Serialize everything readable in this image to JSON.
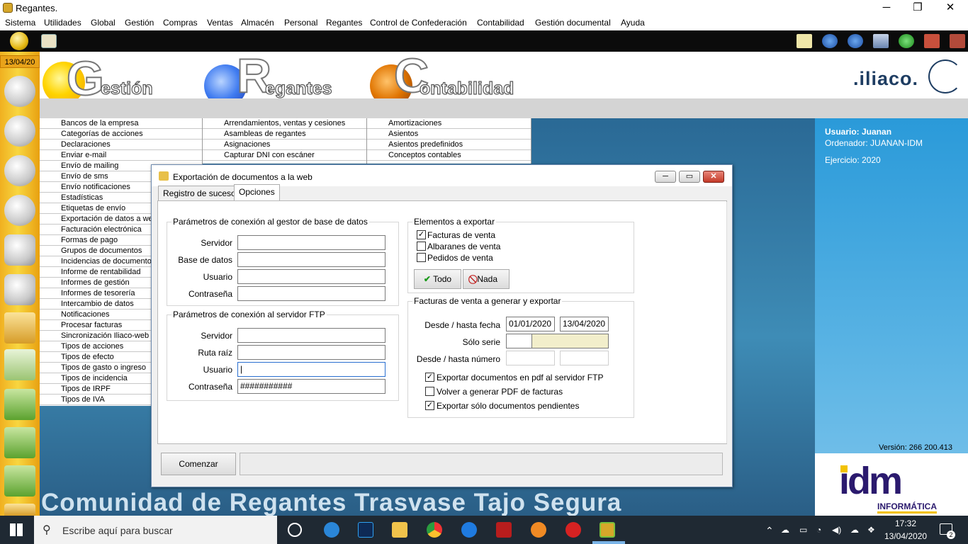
{
  "window": {
    "title": "Regantes.",
    "minimize": "─",
    "maximize": "❐",
    "close": "✕"
  },
  "menu": [
    "Sistema",
    "Utilidades",
    "Global",
    "Gestión",
    "Compras",
    "Ventas",
    "Almacén",
    "Personal",
    "Regantes",
    "Control de Confederación",
    "Contabilidad",
    "Gestión documental",
    "Ayuda"
  ],
  "date_badge": "13/04/20",
  "logos": {
    "gestion": {
      "initial": "G",
      "rest": "estión"
    },
    "regantes": {
      "initial": "R",
      "rest": "egantes"
    },
    "contabilidad": {
      "initial": "C",
      "rest": "ontabilidad"
    },
    "iliaco": ".iliaco."
  },
  "lists": {
    "gestion": [
      "Bancos de la empresa",
      "Categorías de acciones",
      "Declaraciones",
      "Enviar e-mail",
      "Envío de mailing",
      "Envío de sms",
      "Envío notificaciones",
      "Estadísticas",
      "Etiquetas de envío",
      "Exportación de datos a web",
      "Facturación electrónica",
      "Formas de pago",
      "Grupos de documentos",
      "Incidencias de documentos",
      "Informe de rentabilidad",
      "Informes de gestión",
      "Informes de tesorería",
      "Intercambio de datos",
      "Notificaciones",
      "Procesar facturas",
      "Sincronización Iliaco-web",
      "Tipos de acciones",
      "Tipos de efecto",
      "Tipos de gasto o ingreso",
      "Tipos de incidencia",
      "Tipos de IRPF",
      "Tipos de IVA"
    ],
    "regantes": [
      "Arrendamientos, ventas y cesiones",
      "Asambleas de regantes",
      "Asignaciones",
      "Capturar DNI con escáner"
    ],
    "contabilidad": [
      "Amortizaciones",
      "Asientos",
      "Asientos predefinidos",
      "Conceptos contables"
    ]
  },
  "user_panel": {
    "usuario": "Usuario: Juanan",
    "ordenador": "Ordenador: JUANAN-IDM",
    "ejercicio": "Ejercicio: 2020",
    "version": "Versión: 266 200.413"
  },
  "brand": {
    "idm": "idm",
    "sub": "INFORMÁTICA"
  },
  "footer_text": "Comunidad de Regantes Trasvase Tajo Segura",
  "dialog": {
    "title": "Exportación de documentos a la web",
    "tabs": [
      "Registro de sucesos",
      "Opciones"
    ],
    "db_group": {
      "title": "Parámetros de conexión al gestor de base de datos",
      "servidor": "Servidor",
      "base_datos": "Base de datos",
      "usuario": "Usuario",
      "contrasena": "Contraseña",
      "servidor_val": "",
      "base_datos_val": "",
      "usuario_val": "",
      "contrasena_val": ""
    },
    "ftp_group": {
      "title": "Parámetros de conexión al servidor FTP",
      "servidor": "Servidor",
      "ruta": "Ruta raíz",
      "usuario": "Usuario",
      "contrasena": "Contraseña",
      "servidor_val": "",
      "ruta_val": "",
      "usuario_val": "|",
      "contrasena_val": "###########"
    },
    "elementos": {
      "title": "Elementos a exportar",
      "items": [
        {
          "label": "Facturas de venta",
          "checked": true
        },
        {
          "label": "Albaranes de venta",
          "checked": false
        },
        {
          "label": "Pedidos de venta",
          "checked": false
        }
      ],
      "todo": "Todo",
      "nada": "Nada"
    },
    "facturas": {
      "title": "Facturas de venta a generar y exportar",
      "desde_fecha": "Desde / hasta fecha",
      "fecha_desde": "01/01/2020",
      "fecha_hasta": "13/04/2020",
      "solo_serie": "Sólo serie",
      "desde_numero": "Desde / hasta número",
      "opts": [
        {
          "label": "Exportar documentos en pdf al servidor FTP",
          "checked": true
        },
        {
          "label": "Volver a generar PDF de facturas",
          "checked": false
        },
        {
          "label": "Exportar sólo documentos pendientes",
          "checked": true
        }
      ]
    },
    "comenzar": "Comenzar"
  },
  "taskbar": {
    "search_placeholder": "Escribe aquí para buscar",
    "time": "17:32",
    "date": "13/04/2020",
    "notif_count": "2"
  }
}
